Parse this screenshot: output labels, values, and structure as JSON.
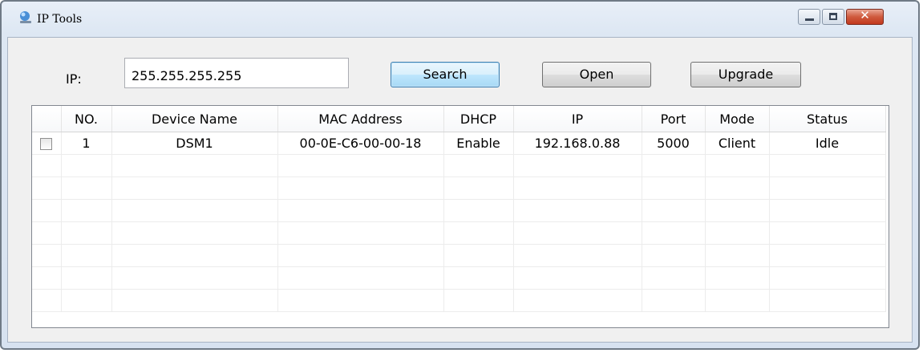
{
  "window": {
    "title": "IP Tools",
    "controls": [
      "minimize-icon",
      "maximize-icon",
      "close-icon"
    ],
    "close_glyph": "✕"
  },
  "toolbar": {
    "ip_label": "IP:",
    "ip_value": "255.255.255.255",
    "search_label": "Search",
    "open_label": "Open",
    "upgrade_label": "Upgrade"
  },
  "table": {
    "columns": [
      "",
      "NO.",
      "Device Name",
      "MAC Address",
      "DHCP",
      "IP",
      "Port",
      "Mode",
      "Status"
    ],
    "rows": [
      {
        "checked": false,
        "no": "1",
        "device_name": "DSM1",
        "mac": "00-0E-C6-00-00-18",
        "dhcp": "Enable",
        "ip": "192.168.0.88",
        "port": "5000",
        "mode": "Client",
        "status": "Idle"
      }
    ],
    "empty_rows": 7
  },
  "colors": {
    "accent": "#3c7fb1",
    "close_button": "#c2391e",
    "frame": "#dde7f3"
  }
}
